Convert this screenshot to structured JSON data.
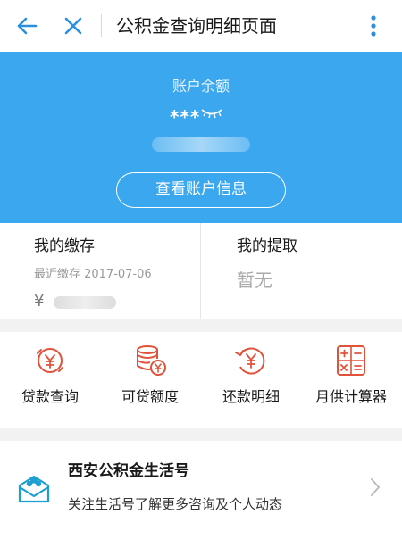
{
  "header": {
    "title": "公积金查询明细页面",
    "back_icon": "back-arrow-icon",
    "close_icon": "close-icon",
    "more_icon": "more-vertical-icon"
  },
  "account": {
    "label": "账户余额",
    "masked_balance": "***",
    "view_button_label": "查看账户信息"
  },
  "payments": {
    "deposit_title": "我的缴存",
    "recent_label": "最近缴存 2017-07-06",
    "amount_prefix": "¥",
    "withdraw_title": "我的提取",
    "withdraw_value": "暂无"
  },
  "tools": [
    {
      "label": "贷款查询",
      "icon": "loan-query-icon"
    },
    {
      "label": "可贷额度",
      "icon": "loan-limit-icon"
    },
    {
      "label": "还款明细",
      "icon": "repayment-icon"
    },
    {
      "label": "月供计算器",
      "icon": "calculator-icon"
    }
  ],
  "life_account": {
    "title": "西安公积金生活号",
    "desc": "关注生活号了解更多咨询及个人动态",
    "icon": "envelope-flower-icon"
  },
  "colors": {
    "primary": "#3ba7ef",
    "accent": "#e0533b"
  }
}
